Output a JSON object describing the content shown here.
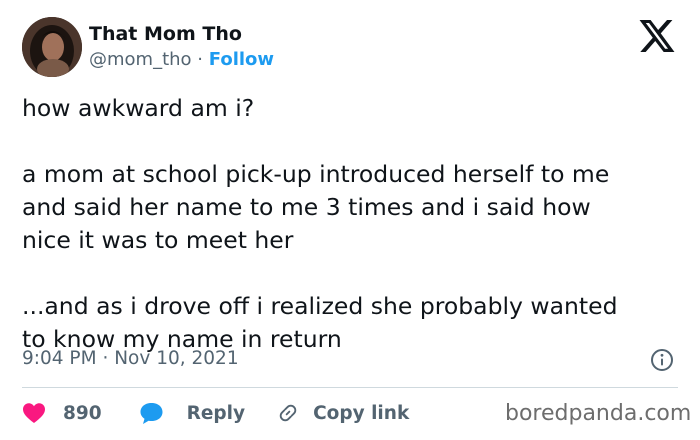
{
  "author": {
    "display_name": "That Mom Tho",
    "handle": "@mom_tho",
    "separator": "·",
    "follow_label": "Follow",
    "avatar_icon": "profile-photo"
  },
  "platform": {
    "logo_icon": "x-logo"
  },
  "tweet": {
    "paragraphs": [
      [
        "how awkward am i?"
      ],
      [
        "a mom at school pick-up introduced herself to me",
        "and said her name to me 3 times and i said how",
        "nice it was to meet her"
      ],
      [
        "...and as i drove off i realized she probably wanted",
        "to know my name in return"
      ]
    ],
    "time": "9:04 PM",
    "separator": "·",
    "date": "Nov 10, 2021"
  },
  "actions": {
    "likes_count": "890",
    "reply_label": "Reply",
    "copy_link_label": "Copy link"
  },
  "colors": {
    "like": "#f91880",
    "reply": "#1d9bf0",
    "link": "#1d9bf0",
    "text": "#0f1419",
    "muted": "#536471"
  },
  "watermark": "boredpanda.com"
}
